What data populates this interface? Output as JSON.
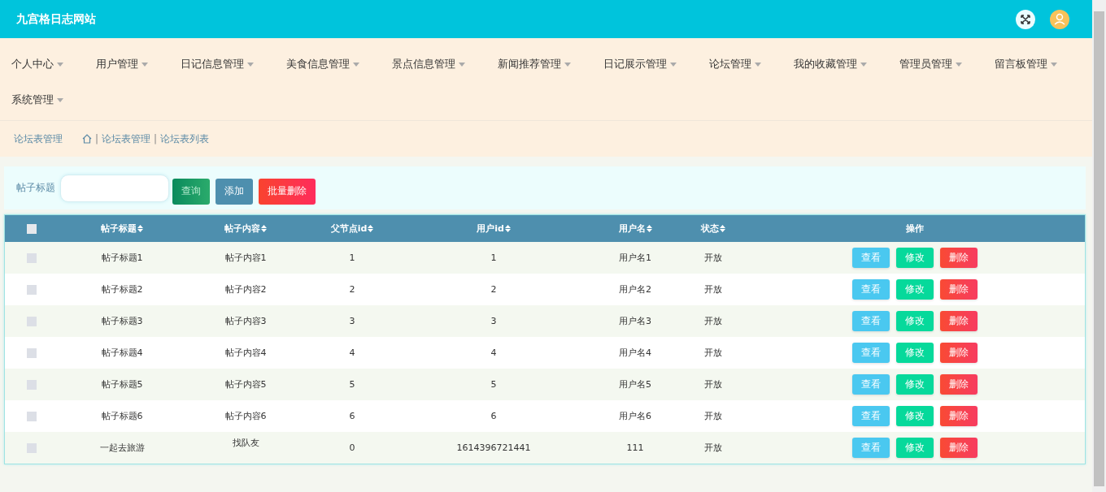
{
  "site_title": "九宫格日志网站",
  "nav": [
    {
      "label": "个人中心"
    },
    {
      "label": "用户管理"
    },
    {
      "label": "日记信息管理"
    },
    {
      "label": "美食信息管理"
    },
    {
      "label": "景点信息管理"
    },
    {
      "label": "新闻推荐管理"
    },
    {
      "label": "日记展示管理"
    },
    {
      "label": "论坛管理"
    },
    {
      "label": "我的收藏管理"
    },
    {
      "label": "管理员管理"
    },
    {
      "label": "留言板管理"
    },
    {
      "label": "系统管理"
    }
  ],
  "breadcrumb": {
    "title": "论坛表管理",
    "path": [
      {
        "separator": "|",
        "label": "论坛表管理"
      },
      {
        "separator": "|",
        "label": "论坛表列表"
      }
    ]
  },
  "search": {
    "label": "帖子标题",
    "buttons": [
      {
        "label": "查询",
        "kind": "search"
      },
      {
        "label": "添加",
        "kind": "add"
      },
      {
        "label": "批量删除",
        "kind": "delete"
      }
    ]
  },
  "table": {
    "select_all_checked": false,
    "columns": [
      {
        "label": "帖子标题",
        "sortable": true
      },
      {
        "label": "帖子内容",
        "sortable": true
      },
      {
        "label": "父节点id",
        "sortable": true
      },
      {
        "label": "用户id",
        "sortable": true
      },
      {
        "label": "用户名",
        "sortable": true
      },
      {
        "label": "状态",
        "sortable": true
      },
      {
        "label": "操作",
        "sortable": false
      }
    ],
    "rows": [
      {
        "checked": false,
        "cells": [
          "帖子标题1",
          "帖子内容1",
          "1",
          "1",
          "用户名1",
          "开放"
        ],
        "actions": [
          {
            "label": "查看",
            "kind": "view"
          },
          {
            "label": "修改",
            "kind": "edit"
          },
          {
            "label": "删除",
            "kind": "delete"
          }
        ]
      },
      {
        "checked": false,
        "cells": [
          "帖子标题2",
          "帖子内容2",
          "2",
          "2",
          "用户名2",
          "开放"
        ],
        "actions": [
          {
            "label": "查看",
            "kind": "view"
          },
          {
            "label": "修改",
            "kind": "edit"
          },
          {
            "label": "删除",
            "kind": "delete"
          }
        ]
      },
      {
        "checked": false,
        "cells": [
          "帖子标题3",
          "帖子内容3",
          "3",
          "3",
          "用户名3",
          "开放"
        ],
        "actions": [
          {
            "label": "查看",
            "kind": "view"
          },
          {
            "label": "修改",
            "kind": "edit"
          },
          {
            "label": "删除",
            "kind": "delete"
          }
        ]
      },
      {
        "checked": false,
        "cells": [
          "帖子标题4",
          "帖子内容4",
          "4",
          "4",
          "用户名4",
          "开放"
        ],
        "actions": [
          {
            "label": "查看",
            "kind": "view"
          },
          {
            "label": "修改",
            "kind": "edit"
          },
          {
            "label": "删除",
            "kind": "delete"
          }
        ]
      },
      {
        "checked": false,
        "cells": [
          "帖子标题5",
          "帖子内容5",
          "5",
          "5",
          "用户名5",
          "开放"
        ],
        "actions": [
          {
            "label": "查看",
            "kind": "view"
          },
          {
            "label": "修改",
            "kind": "edit"
          },
          {
            "label": "删除",
            "kind": "delete"
          }
        ]
      },
      {
        "checked": false,
        "cells": [
          "帖子标题6",
          "帖子内容6",
          "6",
          "6",
          "用户名6",
          "开放"
        ],
        "actions": [
          {
            "label": "查看",
            "kind": "view"
          },
          {
            "label": "修改",
            "kind": "edit"
          },
          {
            "label": "删除",
            "kind": "delete"
          }
        ]
      },
      {
        "checked": false,
        "cells": [
          "一起去旅游",
          "找队友",
          "0",
          "1614396721441",
          "111",
          "开放"
        ],
        "actions": [
          {
            "label": "查看",
            "kind": "view"
          },
          {
            "label": "修改",
            "kind": "edit"
          },
          {
            "label": "删除",
            "kind": "delete"
          }
        ]
      }
    ]
  }
}
